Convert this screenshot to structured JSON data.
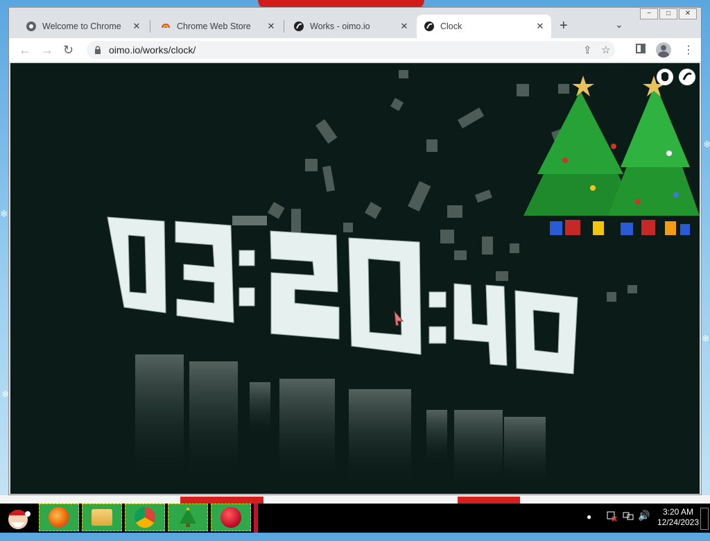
{
  "browser": {
    "tabs": [
      {
        "title": "Welcome to Chrome",
        "icon": "chrome-globe-icon",
        "active": false
      },
      {
        "title": "Chrome Web Store",
        "icon": "web-store-icon",
        "active": false
      },
      {
        "title": "Works - oimo.io",
        "icon": "oimo-icon",
        "active": false
      },
      {
        "title": "Clock",
        "icon": "oimo-icon",
        "active": true
      }
    ],
    "new_tab_label": "+",
    "tab_search_label": "⌄",
    "url": "oimo.io/works/clock/",
    "window_controls": [
      "−",
      "□",
      "✕"
    ]
  },
  "page": {
    "clock_time": "03:20:40",
    "background_color": "#0b1c18",
    "digit_color": "#e6f0ee"
  },
  "taskbar": {
    "apps": [
      {
        "name": "firefox",
        "color": "#e66000"
      },
      {
        "name": "file-manager",
        "color": "#4a90d9"
      },
      {
        "name": "chrome",
        "color": "#db4437"
      },
      {
        "name": "christmas-tree",
        "color": "#1c8a2e"
      },
      {
        "name": "red-ball",
        "color": "#c8102e"
      }
    ],
    "time": "3:20 AM",
    "date": "12/24/2023"
  }
}
